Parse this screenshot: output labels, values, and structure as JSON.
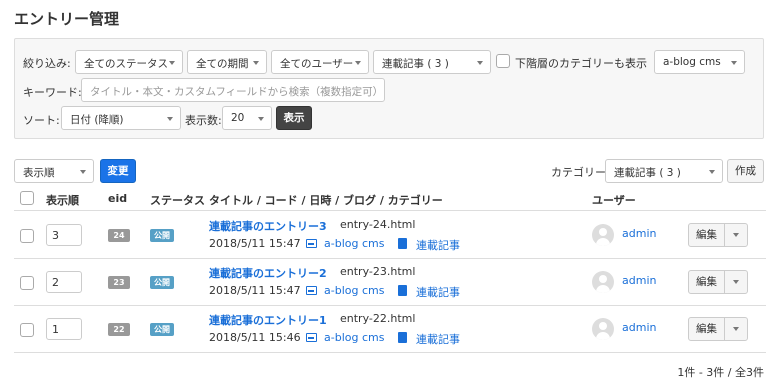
{
  "page": {
    "title": "エントリー管理"
  },
  "filters": {
    "label": "絞り込み:",
    "status": "全てのステータス",
    "period": "全ての期間",
    "user": "全てのユーザー",
    "category": "連載記事 ( 3 )",
    "include_sub_label": "下階層のカテゴリーも表示",
    "blog": "a-blog cms",
    "keyword_label": "キーワード:",
    "keyword_placeholder": "タイトル・本文・カスタムフィールドから検索（複数指定可）",
    "sort_label": "ソート:",
    "sort": "日付 (降順)",
    "limit_label": "表示数:",
    "limit": "20",
    "submit_label": "表示"
  },
  "toolbar": {
    "order_select": "表示順",
    "change_label": "変更",
    "category_label": "カテゴリー",
    "category_select": "連載記事 ( 3 )",
    "create_label": "作成"
  },
  "table": {
    "headers": {
      "order": "表示順",
      "eid": "eid",
      "status": "ステータス",
      "info": "タイトル / コード / 日時 / ブログ / カテゴリー",
      "user": "ユーザー"
    },
    "rows": [
      {
        "order": "3",
        "eid": "24",
        "status": "公開",
        "title": "連載記事のエントリー3",
        "code": "entry-24.html",
        "datetime": "2018/5/11 15:47",
        "blog": "a-blog cms",
        "category": "連載記事",
        "user": "admin",
        "edit": "編集"
      },
      {
        "order": "2",
        "eid": "23",
        "status": "公開",
        "title": "連載記事のエントリー2",
        "code": "entry-23.html",
        "datetime": "2018/5/11 15:47",
        "blog": "a-blog cms",
        "category": "連載記事",
        "user": "admin",
        "edit": "編集"
      },
      {
        "order": "1",
        "eid": "22",
        "status": "公開",
        "title": "連載記事のエントリー1",
        "code": "entry-22.html",
        "datetime": "2018/5/11 15:46",
        "blog": "a-blog cms",
        "category": "連載記事",
        "user": "admin",
        "edit": "編集"
      }
    ]
  },
  "pager": {
    "text": "1件 - 3件 / 全3件"
  }
}
